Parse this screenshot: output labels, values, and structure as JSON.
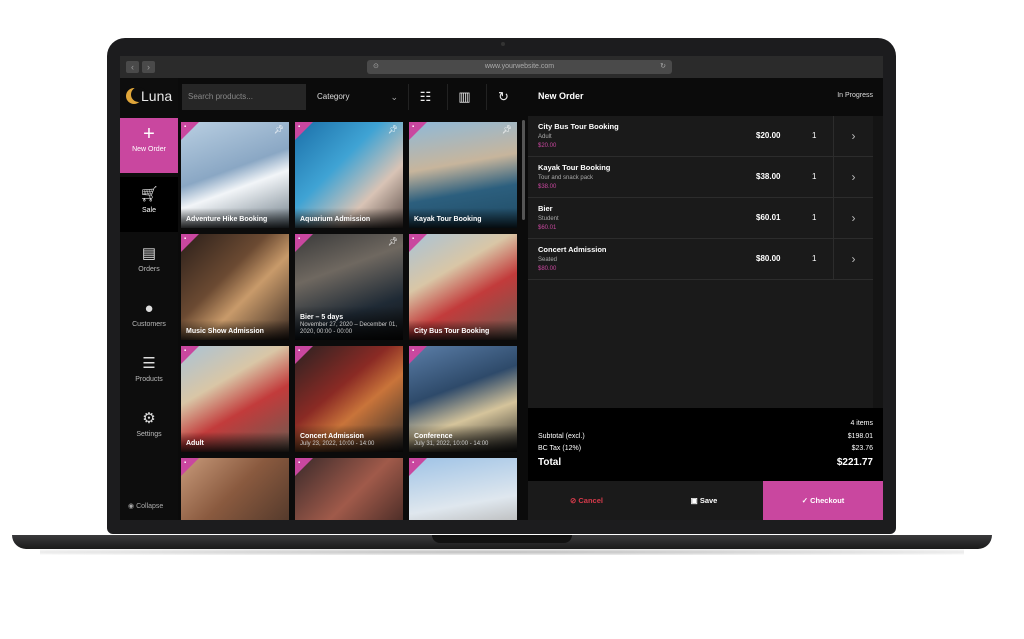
{
  "browser": {
    "url": "www.yourwebsite.com"
  },
  "app": {
    "logo_text": "Luna"
  },
  "sidebar": {
    "items": [
      {
        "label": "New Order",
        "icon": "plus-icon"
      },
      {
        "label": "Sale",
        "icon": "cart-icon"
      },
      {
        "label": "Orders",
        "icon": "receipt-icon"
      },
      {
        "label": "Customers",
        "icon": "user-icon"
      },
      {
        "label": "Products",
        "icon": "list-icon"
      },
      {
        "label": "Settings",
        "icon": "gear-icon"
      }
    ],
    "collapse_label": "Collapse"
  },
  "toolbar": {
    "search_placeholder": "Search products...",
    "category_label": "Category"
  },
  "products": [
    {
      "title": "Adventure Hike Booking",
      "sub": "",
      "pinned": true
    },
    {
      "title": "Aquarium Admission",
      "sub": "",
      "pinned": true
    },
    {
      "title": "Kayak Tour Booking",
      "sub": "",
      "pinned": true
    },
    {
      "title": "Music Show Admission",
      "sub": "",
      "pinned": false
    },
    {
      "title": "Bier – 5 days",
      "sub": "November 27, 2020 – December 01, 2020, 00:00 - 00:00",
      "pinned": true
    },
    {
      "title": "City Bus Tour Booking",
      "sub": "",
      "pinned": false
    },
    {
      "title": "Adult",
      "sub": "",
      "pinned": false
    },
    {
      "title": "Concert Admission",
      "sub": "July 23, 2022, 10:00 - 14:00",
      "pinned": false
    },
    {
      "title": "Conference",
      "sub": "July 31, 2022, 10:00 - 14:00",
      "pinned": false
    },
    {
      "title": "",
      "sub": "",
      "pinned": false
    },
    {
      "title": "",
      "sub": "",
      "pinned": false
    },
    {
      "title": "",
      "sub": "",
      "pinned": false
    }
  ],
  "order": {
    "title": "New Order",
    "status": "In Progress",
    "lines": [
      {
        "name": "City Bus Tour Booking",
        "variant": "Adult",
        "unit_price": "$20.00",
        "price": "$20.00",
        "qty": "1"
      },
      {
        "name": "Kayak Tour Booking",
        "variant": "Tour and snack pack",
        "unit_price": "$38.00",
        "price": "$38.00",
        "qty": "1"
      },
      {
        "name": "Bier",
        "variant": "Student",
        "unit_price": "$60.01",
        "price": "$60.01",
        "qty": "1"
      },
      {
        "name": "Concert Admission",
        "variant": "Seated",
        "unit_price": "$80.00",
        "price": "$80.00",
        "qty": "1"
      }
    ],
    "item_count": "4 items",
    "subtotal_label": "Subtotal (excl.)",
    "subtotal": "$198.01",
    "tax_label": "BC Tax (12%)",
    "tax": "$23.76",
    "total_label": "Total",
    "total": "$221.77",
    "cancel_label": "Cancel",
    "save_label": "Save",
    "checkout_label": "Checkout"
  },
  "colors": {
    "accent": "#c9479f",
    "cancel": "#d43a4a",
    "panel": "#1a1a1a"
  }
}
